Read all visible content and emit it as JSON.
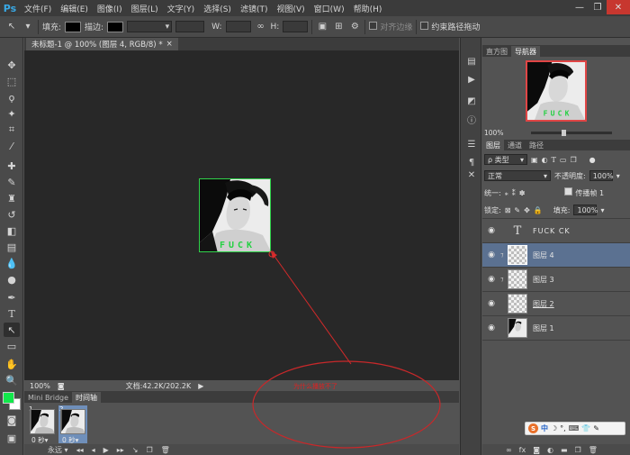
{
  "app": {
    "logo": "Ps"
  },
  "menu": [
    "文件(F)",
    "编辑(E)",
    "图像(I)",
    "图层(L)",
    "文字(Y)",
    "选择(S)",
    "滤镜(T)",
    "视图(V)",
    "窗口(W)",
    "帮助(H)"
  ],
  "window_controls": {
    "minimize": "—",
    "restore": "❐",
    "close": "✕"
  },
  "options_bar": {
    "tool_glyph": "↖",
    "fill_label": "填充:",
    "stroke_label": "描边:",
    "w_label": "W:",
    "h_label": "H:",
    "align_edges_label": "对齐边缘",
    "constrain_path_label": "约束路径拖动",
    "constrain_path_checked": false
  },
  "document": {
    "tab_title": "未标题-1 @ 100% (图层 4, RGB/8) *",
    "tab_close": "×",
    "zoom": "100%",
    "doc_info": "文档:42.2K/202.2K",
    "artwork_text": "FUCK"
  },
  "colors": {
    "foreground": "#12e84b",
    "background": "#ffffff",
    "annotation": "#d42a2a",
    "selected_layer": "#5b7191"
  },
  "timeline": {
    "tabs": [
      "Mini Bridge",
      "时间轴"
    ],
    "active_tab": "时间轴",
    "frames": [
      {
        "number": "1",
        "delay": "0 秒▾"
      },
      {
        "number": "2",
        "delay": "0 秒▾"
      }
    ],
    "loop": "永远 ▾"
  },
  "navigator": {
    "tabs": [
      "直方图",
      "导航器"
    ],
    "active_tab": "导航器",
    "zoom": "100%",
    "zoom_level": 0.4
  },
  "layers": {
    "tabs": [
      "图层",
      "通道",
      "路径"
    ],
    "active_tab": "图层",
    "filter_label": "ρ 类型",
    "blend_mode": "正常",
    "opacity_label": "不透明度:",
    "opacity_value": "100%",
    "unify_label": "统一:",
    "propagate_label": "传播帧 1",
    "lock_label": "锁定:",
    "fill_label": "填充:",
    "fill_value": "100%",
    "items": [
      {
        "name": "FUCK CK",
        "kind": "text",
        "selected": false
      },
      {
        "name": "图层 4",
        "kind": "empty",
        "selected": true
      },
      {
        "name": "图层 3",
        "kind": "empty",
        "selected": false
      },
      {
        "name": "图层 2",
        "kind": "empty",
        "selected": false
      },
      {
        "name": "图层 1",
        "kind": "photo",
        "selected": false
      }
    ]
  },
  "annotation": {
    "text": "为什么播放不了"
  },
  "ime": {
    "logo": "S",
    "chars": [
      "中",
      "☽",
      "°,",
      "⌨",
      "👕",
      "✎"
    ]
  }
}
